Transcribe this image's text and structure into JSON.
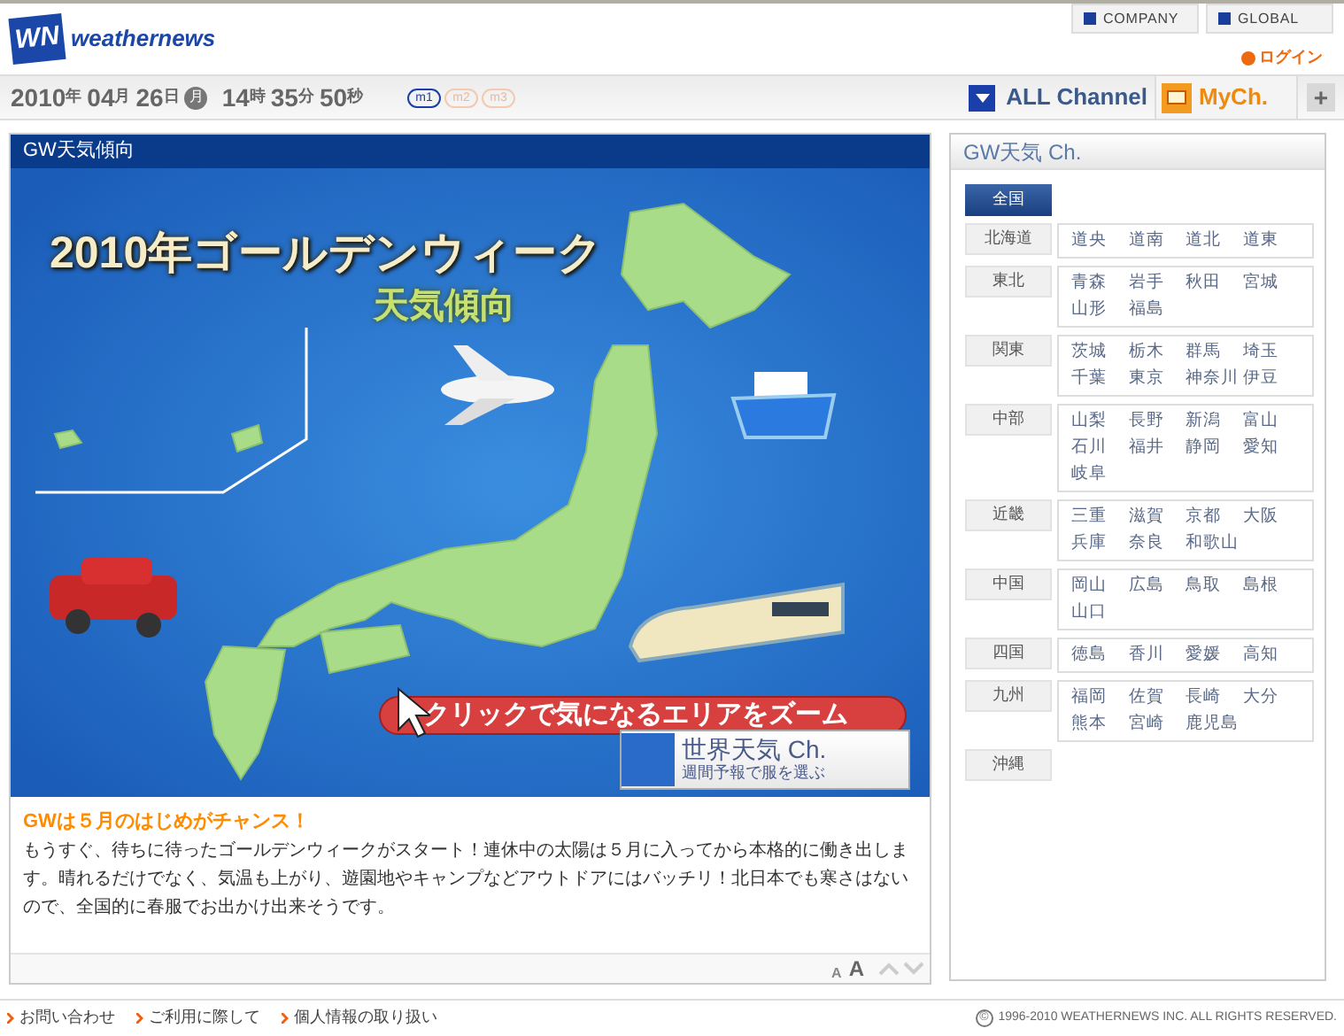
{
  "header": {
    "logo_mark": "WN",
    "logo_text": "weathernews",
    "links": [
      "COMPANY",
      "GLOBAL"
    ],
    "login": "ログイン"
  },
  "datebar": {
    "date": [
      {
        "num": "2010",
        "unit": "年"
      },
      {
        "num": "04",
        "unit": "月"
      },
      {
        "num": "26",
        "unit": "日"
      }
    ],
    "weekday": "月",
    "time": [
      {
        "num": "14",
        "unit": "時"
      },
      {
        "num": "35",
        "unit": "分"
      },
      {
        "num": "50",
        "unit": "秒"
      }
    ],
    "modes": [
      {
        "label": "m1",
        "selected": true
      },
      {
        "label": "m2",
        "selected": false
      },
      {
        "label": "m3",
        "selected": false
      }
    ],
    "all_channel": "ALL Channel",
    "my_channel": "MyCh.",
    "add": "+"
  },
  "main": {
    "title": "GW天気傾向",
    "map_title": "2010年ゴールデンウィーク",
    "map_subtitle": "天気傾向",
    "zoom_hint": "クリックで気になるエリアをズーム",
    "world_title": "世界天気 Ch.",
    "world_sub": "週間予報で服を選ぶ",
    "headline": "GWは５月のはじめがチャンス！",
    "body": "もうすぐ、待ちに待ったゴールデンウィークがスタート！連休中の太陽は５月に入ってから本格的に働き出します。晴れるだけでなく、気温も上がり、遊園地やキャンプなどアウトドアにはバッチリ！北日本でも寒さはないので、全国的に春服でお出かけ出来そうです。",
    "font_small": "A",
    "font_large": "A"
  },
  "sidebar": {
    "title": "GW天気 Ch.",
    "regions": [
      {
        "name": "全国",
        "selected": true
      },
      {
        "name": "北海道",
        "selected": false,
        "areas": [
          "道央",
          "道南",
          "道北",
          "道東"
        ]
      },
      {
        "name": "東北",
        "selected": false,
        "areas": [
          "青森",
          "岩手",
          "秋田",
          "宮城",
          "山形",
          "福島"
        ]
      },
      {
        "name": "関東",
        "selected": false,
        "areas": [
          "茨城",
          "栃木",
          "群馬",
          "埼玉",
          "千葉",
          "東京",
          "神奈川",
          "伊豆"
        ]
      },
      {
        "name": "中部",
        "selected": false,
        "areas": [
          "山梨",
          "長野",
          "新潟",
          "富山",
          "石川",
          "福井",
          "静岡",
          "愛知",
          "岐阜"
        ]
      },
      {
        "name": "近畿",
        "selected": false,
        "areas": [
          "三重",
          "滋賀",
          "京都",
          "大阪",
          "兵庫",
          "奈良",
          "和歌山"
        ]
      },
      {
        "name": "中国",
        "selected": false,
        "areas": [
          "岡山",
          "広島",
          "鳥取",
          "島根",
          "山口"
        ]
      },
      {
        "name": "四国",
        "selected": false,
        "areas": [
          "徳島",
          "香川",
          "愛媛",
          "高知"
        ]
      },
      {
        "name": "九州",
        "selected": false,
        "areas": [
          "福岡",
          "佐賀",
          "長崎",
          "大分",
          "熊本",
          "宮崎",
          "鹿児島"
        ]
      },
      {
        "name": "沖縄",
        "selected": false
      }
    ]
  },
  "footer": {
    "links": [
      "お問い合わせ",
      "ご利用に際して",
      "個人情報の取り扱い"
    ],
    "copyright": "1996-2010 WEATHERNEWS INC. ALL RIGHTS RESERVED.",
    "copyright_mark": "©"
  }
}
